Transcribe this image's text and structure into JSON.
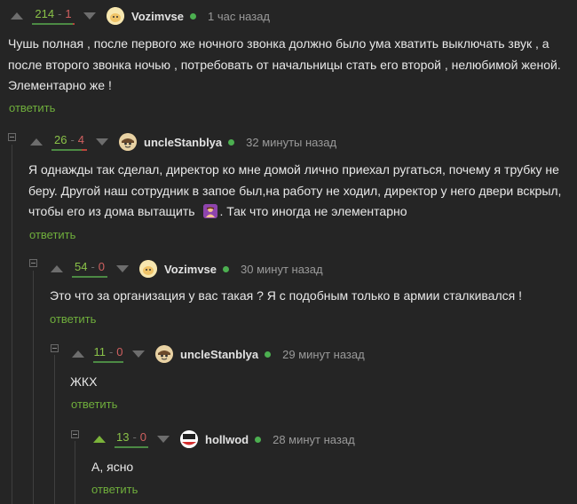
{
  "comments": [
    {
      "rating": {
        "plus": "214",
        "minus": "1"
      },
      "username": "Vozimvse",
      "time": "1 час назад",
      "text_lines": [
        "Чушь полная , после первого же ночного звонка должно было ума хватить выключать звук , а",
        "после второго звонка ночью , потребовать от начальницы стать его второй , нелюбимой женой.",
        "Элементарно же !"
      ],
      "reply": "ответить"
    },
    {
      "rating": {
        "plus": "26",
        "minus": "4"
      },
      "username": "uncleStanblya",
      "time": "32 минуты назад",
      "text_lines": [
        "Я однажды так сделал, директор ко мне домой лично приехал ругаться, почему я трубку не",
        "беру. Другой наш сотрудник в запое был,на работу не ходил, директор у него двери вскрыл,"
      ],
      "text_line3_before": "чтобы его из дома вытащить",
      "text_line3_after": ". Так что иногда не элементарно",
      "emoji": "facepalm-emoji",
      "reply": "ответить"
    },
    {
      "rating": {
        "plus": "54",
        "minus": "0"
      },
      "username": "Vozimvse",
      "time": "30 минут назад",
      "text_lines": [
        "Это что за организация у вас такая ? Я с подобным только в армии сталкивался !"
      ],
      "reply": "ответить"
    },
    {
      "rating": {
        "plus": "11",
        "minus": "0"
      },
      "username": "uncleStanblya",
      "time": "29 минут назад",
      "text_lines": [
        "ЖКХ"
      ],
      "reply": "ответить"
    },
    {
      "rating": {
        "plus": "13",
        "minus": "0"
      },
      "username": "hollwod",
      "time": "28 минут назад",
      "text_lines": [
        "А, ясно"
      ],
      "reply": "ответить"
    }
  ],
  "colors": {
    "background": "#252525",
    "reply_link": "#6fae3c",
    "rating_plus": "#8ac248",
    "rating_minus": "#d06060",
    "online_dot": "#4caf50"
  },
  "icons": [
    "upvote-icon",
    "downvote-icon",
    "collapse-icon",
    "online-indicator"
  ]
}
